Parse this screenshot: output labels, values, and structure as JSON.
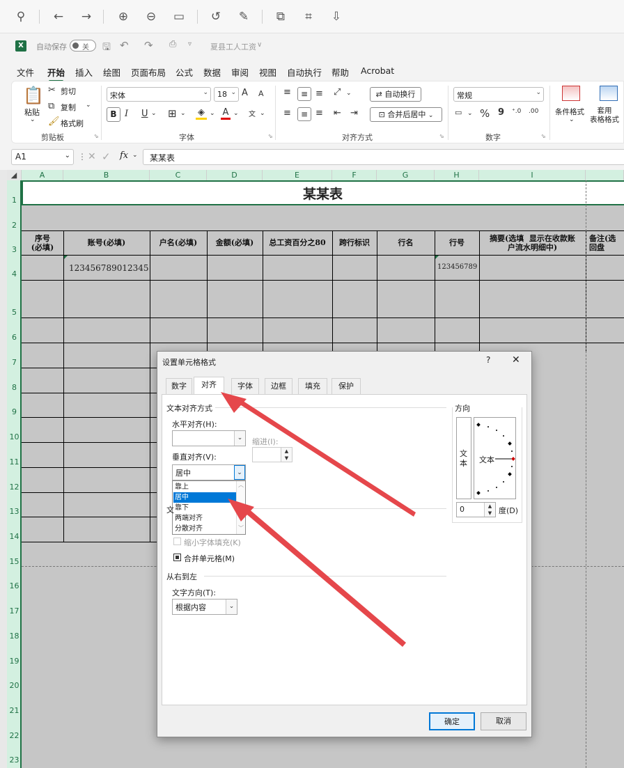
{
  "viewer": {
    "icons": [
      "pin-icon",
      "back-arrow-icon",
      "forward-arrow-icon",
      "zoom-in-icon",
      "zoom-out-icon",
      "fit-icon",
      "rotate-icon",
      "edit-icon",
      "translate-icon",
      "scan-icon",
      "save-icon"
    ]
  },
  "titlebar": {
    "autosave_label": "自动保存",
    "autosave_state": "关",
    "filename": "夏县工人工资",
    "filename_arrow": "∨"
  },
  "ribbon_tabs": [
    "文件",
    "开始",
    "插入",
    "绘图",
    "页面布局",
    "公式",
    "数据",
    "审阅",
    "视图",
    "自动执行",
    "帮助",
    "Acrobat"
  ],
  "clipboard": {
    "paste": "粘贴",
    "cut": "剪切",
    "copy": "复制",
    "format_painter": "格式刷",
    "label": "剪贴板"
  },
  "font": {
    "name": "宋体",
    "size": "18",
    "label": "字体",
    "bold": "B",
    "italic": "I",
    "underline": "U",
    "grow": "A",
    "shrink": "A"
  },
  "alignment": {
    "wrap": "自动换行",
    "merge": "合并后居中",
    "label": "对齐方式"
  },
  "number": {
    "format": "常规",
    "label": "数字",
    "percent": "%",
    "comma": "9"
  },
  "styles": {
    "conditional": "条件格式",
    "table_format": "套用\n表格格式"
  },
  "formula_bar": {
    "name_box": "A1",
    "fx": "fx",
    "content": "某某表"
  },
  "grid": {
    "columns": [
      "A",
      "B",
      "C",
      "D",
      "E",
      "F",
      "G",
      "H",
      "I"
    ],
    "rows": [
      "1",
      "2",
      "3",
      "4",
      "5",
      "6",
      "7",
      "8",
      "9",
      "10",
      "11",
      "12",
      "13",
      "14",
      "15",
      "16",
      "17",
      "18",
      "19",
      "20",
      "21",
      "22",
      "23"
    ],
    "title": "某某表",
    "headers": [
      "序号\n(必填)",
      "账号(必填)",
      "户名(必填)",
      "金额(必填)",
      "总工资百分之80",
      "跨行标识",
      "行名",
      "行号",
      "摘要(选填  显示在收款账\n户流水明细中)",
      "备注(选\n回盘"
    ],
    "row4": {
      "account": "123456789012345",
      "bank_no": "123456789"
    }
  },
  "dialog": {
    "title": "设置单元格格式",
    "help": "?",
    "close": "✕",
    "tabs": [
      "数字",
      "对齐",
      "字体",
      "边框",
      "填充",
      "保护"
    ],
    "active_tab": "对齐",
    "text_align_group": "文本对齐方式",
    "horizontal_label": "水平对齐(H):",
    "horizontal_value": "",
    "indent_label": "缩进(I):",
    "vertical_label": "垂直对齐(V):",
    "vertical_value": "居中",
    "vertical_options": [
      "靠上",
      "居中",
      "靠下",
      "两端对齐",
      "分散对齐"
    ],
    "text_control_group": "文",
    "shrink_label": "缩小字体填充(K)",
    "merge_label": "合并单元格(M)",
    "rtl_group": "从右到左",
    "direction_label": "文字方向(T):",
    "direction_value": "根据内容",
    "orientation_group": "方向",
    "orientation_vertical_text": "文\n本",
    "orientation_text": "文本",
    "degree_value": "0",
    "degree_label": "度(D)",
    "ok": "确定",
    "cancel": "取消"
  },
  "colors": {
    "accent": "#1f7145",
    "arrow": "#e5474b",
    "selection": "#0078d7"
  }
}
